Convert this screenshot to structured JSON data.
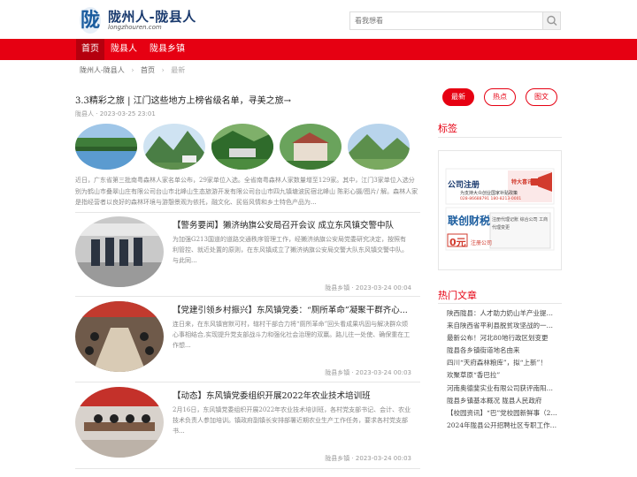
{
  "brand": {
    "logo_char": "陇",
    "title": "陇州人-陇县人",
    "domain": "longzhouren.com"
  },
  "search": {
    "placeholder": "看我想看"
  },
  "nav": {
    "items": [
      "首页",
      "陇县人",
      "陇县乡镇"
    ]
  },
  "breadcrumb": {
    "site": "陇州人-陇县人",
    "home": "首页",
    "current": "最新"
  },
  "featured": {
    "title": "3.3精彩之旅 | 江门这些地方上榜省级名单，寻美之旅→",
    "author": "陇县人",
    "date": "2023-03-25 23:01",
    "excerpt": "近日，广东省第三批南粤森林人家名单公布，29家单位入选。全省南粤森林人家数量增至129家。其中，江门3家单位入选分别为鹤山市叠翠山庄有限公司台山市北峰山生态旅游开发有限公司台山市四九镇塘波民宿北峰山 陈彩心摄/图片/ 解。森林人家是指经营者以良好的森林环境与游憩景观为依托，融文化、民俗风情和乡土特色产品为..."
  },
  "articles": [
    {
      "title": "【警务要闻】獭济纳旗公安局召开会议 成立东风镇交警中队",
      "excerpt": "为加强G213国道的道路交通秩序管理工作，经獭济纳旗公安局党委研究决定，按照有利管控、就近处置的原则，在东风镇成立了獭济纳旗公安局交警大队东风镇交警中队。与此同...",
      "source": "陇县乡镇",
      "date": "2023-03-24 00:04"
    },
    {
      "title": "【党建引领乡村振兴】东风镇党委：“厕所革命”凝聚干群齐心...",
      "excerpt": "连日来，在东风镇官默可村，辖村干部合力将“厕所革命”回头看成果巩固与解决群众烦心事相结合,实现提升党支部战斗力和强化社会治理的双赢。路儿往一处使、确保重在工作想...",
      "source": "陇县乡镇",
      "date": "2023-03-24 00:03"
    },
    {
      "title": "【动态】东风镇党委组织开展2022年农业技术培训班",
      "excerpt": "2月16日，东风镇党委组织开展2022年农业技术培训班，各村党支部书记、会计、农业技术负责人参加培训。镇政府副镇长安排部署近期农业生产工作任务，要求各村党支部书...",
      "source": "陇县乡镇",
      "date": "2023-03-24 00:03"
    }
  ],
  "sidebar": {
    "tabs": [
      "最新",
      "热点",
      "图文"
    ],
    "tags_heading": "标签",
    "ad": {
      "brand1": "公司注册",
      "highlight": "特大喜讯",
      "line1": "为支持大众创业国家补贴政策",
      "phone": "028-86688791 180-8213-0001",
      "brand2": "联创财税",
      "price": "0元",
      "price_label": "注册公司",
      "badge": "注册代理记账 综合公司 工商代理变更"
    },
    "hot_heading": "热门文章",
    "hot_items": [
      "陕西陇县：人才助力奶山羊产业提质...",
      "来自陕西省平利县脱贫攻坚战的一线...",
      "最新公布！河北80地行政区划变更",
      "陇县各乡镇街道地名由来",
      "四川“天府森林粮库”，拟“上新”！",
      "欢聚草原“香巴拉”",
      "河南奥德斐实业有限公司获评南阳市...",
      "陇县乡镇基本概况 陇县人民政府",
      "【校园资讯】“巴”党校园新鲜事（2...",
      "2024年陇县公开招聘社区专职工作人..."
    ]
  },
  "colors": {
    "accent": "#e60012",
    "nav_active": "#b5000e",
    "logo_blue": "#1a3a6e"
  }
}
